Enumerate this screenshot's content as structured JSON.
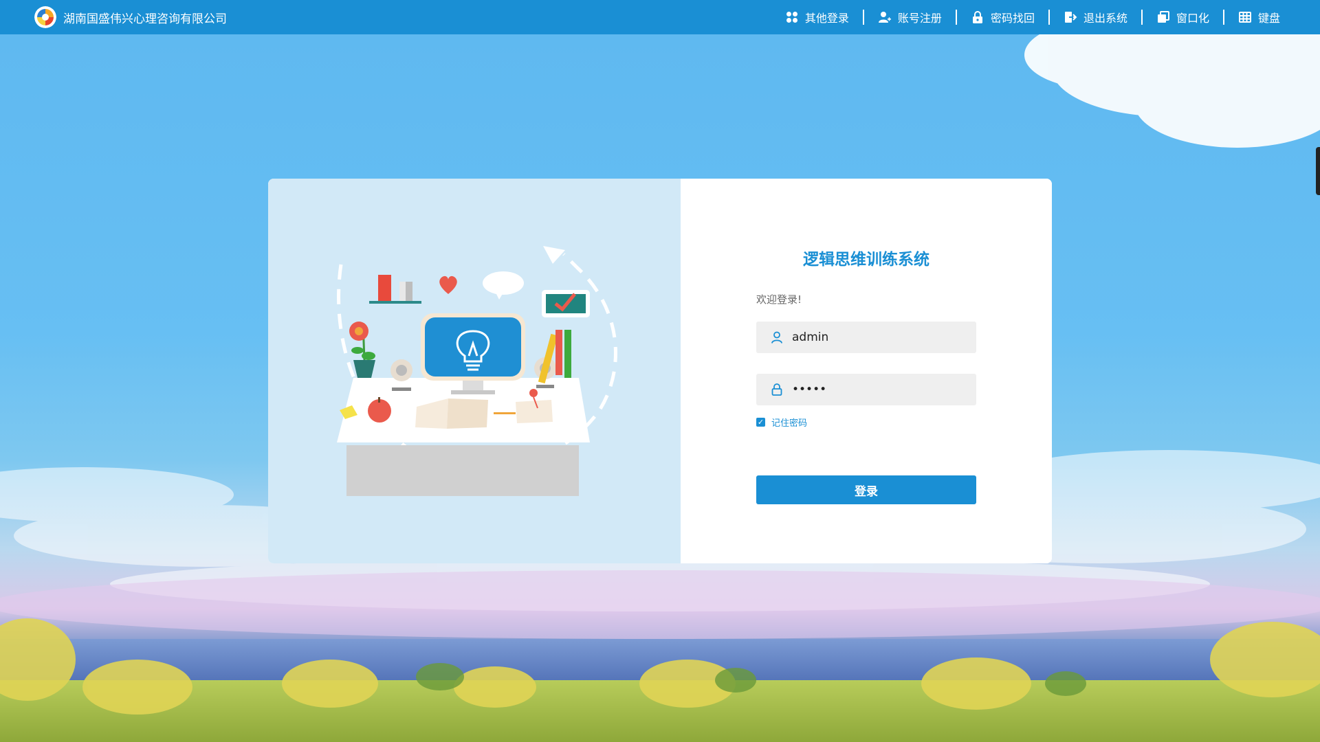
{
  "header": {
    "company_name": "湖南国盛伟兴心理咨询有限公司",
    "logo_icon": "company-logo-icon",
    "nav": [
      {
        "label": "其他登录",
        "icon": "apps-grid-icon"
      },
      {
        "label": "账号注册",
        "icon": "user-add-icon"
      },
      {
        "label": "密码找回",
        "icon": "lock-icon"
      },
      {
        "label": "退出系统",
        "icon": "exit-icon"
      },
      {
        "label": "窗口化",
        "icon": "window-icon"
      },
      {
        "label": "键盘",
        "icon": "keyboard-icon"
      }
    ]
  },
  "login": {
    "system_title": "逻辑思维训练系统",
    "welcome": "欢迎登录!",
    "username_value": "admin",
    "password_value": "admin",
    "remember_label": "记住密码",
    "remember_checked": true,
    "login_button": "登录"
  },
  "colors": {
    "accent": "#1a8fd4",
    "illustration_bg": "#d2e9f7",
    "field_bg": "#efefef"
  }
}
